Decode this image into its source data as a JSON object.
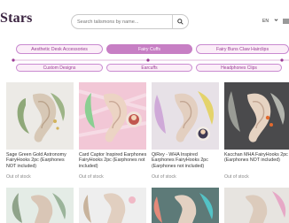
{
  "header": {
    "logo_text": "Stars",
    "search_placeholder": "Search talismons by name...",
    "language": "EN"
  },
  "categories": {
    "row1": [
      "Aesthetic Desk Accessories",
      "Fairy Cuffs",
      "Fairy Buns Claw Hairclips"
    ],
    "row2": [
      "Custom Designs",
      "Earcuffs",
      "Headphones Clips"
    ],
    "active": "Fairy Cuffs"
  },
  "products": [
    {
      "title": "Sage Green Gold Astronomy FairyHooks 2pc (Earphones NOT included)",
      "stock": "Out of stock"
    },
    {
      "title": "Card Captor Inspired Earphones FairyHooks 2pc (Earphones not included)",
      "stock": "Out of stock"
    },
    {
      "title": "QiRey - WHA Inspired Earphones FairyHooks 2pc (Earphones not included)",
      "stock": "Out of stock"
    },
    {
      "title": "Kacchan MHA FairyHooks 2pc (Earphones NOT included)",
      "stock": "Out of stock"
    }
  ],
  "colors": {
    "accent": "#c77fc4",
    "accent_text": "#9a3b94",
    "track": "#e7c6e4"
  }
}
